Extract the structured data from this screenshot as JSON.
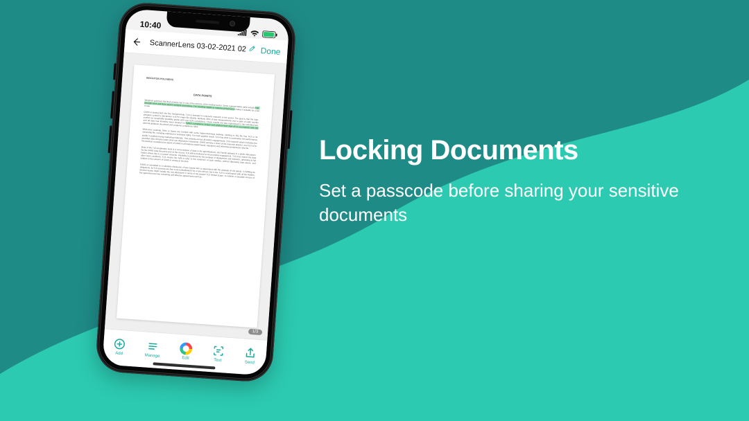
{
  "feature": {
    "title": "Locking Documents",
    "subtitle": "Set a passcode before sharing your sensitive documents"
  },
  "colors": {
    "bg_dark": "#1f8b87",
    "bg_light": "#2ccab1",
    "accent": "#1aa99d"
  },
  "status_bar": {
    "time": "10:40"
  },
  "nav": {
    "document_title": "ScannerLens 03-02-2021 02",
    "done_label": "Done"
  },
  "page_counter": "1/3",
  "tabs": {
    "add": "Add",
    "manage": "Manage",
    "edit": "Edit",
    "text": "Text",
    "send": "Send"
  },
  "icons": {
    "back": "back-arrow-icon",
    "lock": "lock-icon",
    "edit_pen": "edit-pencil-icon",
    "signal": "signal-icon",
    "wifi": "wifi-icon",
    "battery": "battery-icon",
    "add": "plus-circle-icon",
    "manage": "stack-icon",
    "editring": "color-ring-icon",
    "text": "scan-text-icon",
    "send": "share-icon"
  }
}
